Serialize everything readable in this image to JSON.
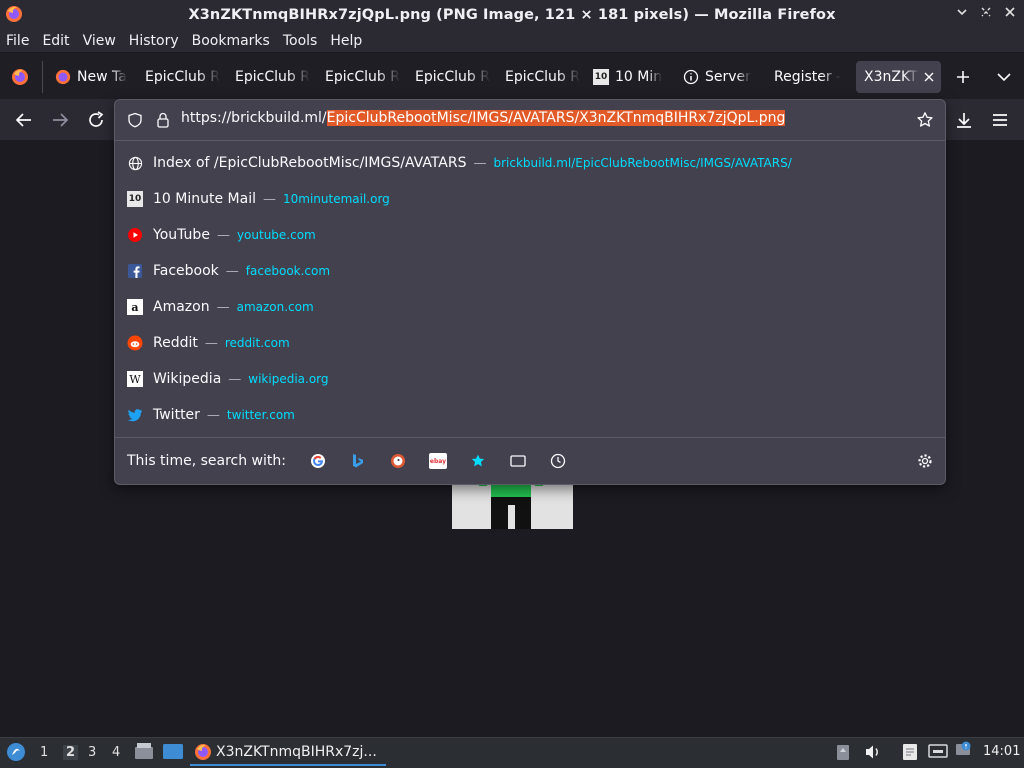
{
  "window": {
    "title": "X3nZKTnmqBIHRx7zjQpL.png (PNG Image, 121 × 181 pixels) — Mozilla Firefox"
  },
  "menu": [
    "File",
    "Edit",
    "View",
    "History",
    "Bookmarks",
    "Tools",
    "Help"
  ],
  "tabs": [
    {
      "label": "New Ta",
      "icon": "firefox-icon"
    },
    {
      "label": "EpicClub R",
      "icon": ""
    },
    {
      "label": "EpicClub R",
      "icon": ""
    },
    {
      "label": "EpicClub R",
      "icon": ""
    },
    {
      "label": "EpicClub R",
      "icon": ""
    },
    {
      "label": "EpicClub R",
      "icon": ""
    },
    {
      "label": "10 Min",
      "icon": "ten-minute-mail-icon"
    },
    {
      "label": "Server",
      "icon": "info-icon"
    },
    {
      "label": "Register -",
      "icon": ""
    },
    {
      "label": "X3nZKT",
      "icon": ""
    }
  ],
  "urlbar": {
    "prefix": "https://brickbuild.ml/",
    "selected": "EpicClubRebootMisc/IMGS/AVATARS/X3nZKTnmqBIHRx7zjQpL.png"
  },
  "results": [
    {
      "title": "Index of /EpicClubRebootMisc/IMGS/AVATARS",
      "url": "brickbuild.ml/EpicClubRebootMisc/IMGS/AVATARS/",
      "icon": "globe-icon"
    },
    {
      "title": "10 Minute Mail",
      "url": "10minutemail.org",
      "icon": "ten-minute-mail-icon"
    },
    {
      "title": "YouTube",
      "url": "youtube.com",
      "icon": "youtube-icon"
    },
    {
      "title": "Facebook",
      "url": "facebook.com",
      "icon": "facebook-icon"
    },
    {
      "title": "Amazon",
      "url": "amazon.com",
      "icon": "amazon-icon"
    },
    {
      "title": "Reddit",
      "url": "reddit.com",
      "icon": "reddit-icon"
    },
    {
      "title": "Wikipedia",
      "url": "wikipedia.org",
      "icon": "wikipedia-icon"
    },
    {
      "title": "Twitter",
      "url": "twitter.com",
      "icon": "twitter-icon"
    }
  ],
  "search_with_label": "This time, search with:",
  "separator": "—",
  "taskbar": {
    "workspaces": [
      "1",
      "2",
      "3",
      "4"
    ],
    "active_workspace": "2",
    "task_title": "X3nZKTnmqBIHRx7zj...",
    "clock": "14:01"
  },
  "colors": {
    "accent_highlight": "#e25a28",
    "link": "#00ddff",
    "panel": "#42414d",
    "chrome": "#2b2a33"
  }
}
